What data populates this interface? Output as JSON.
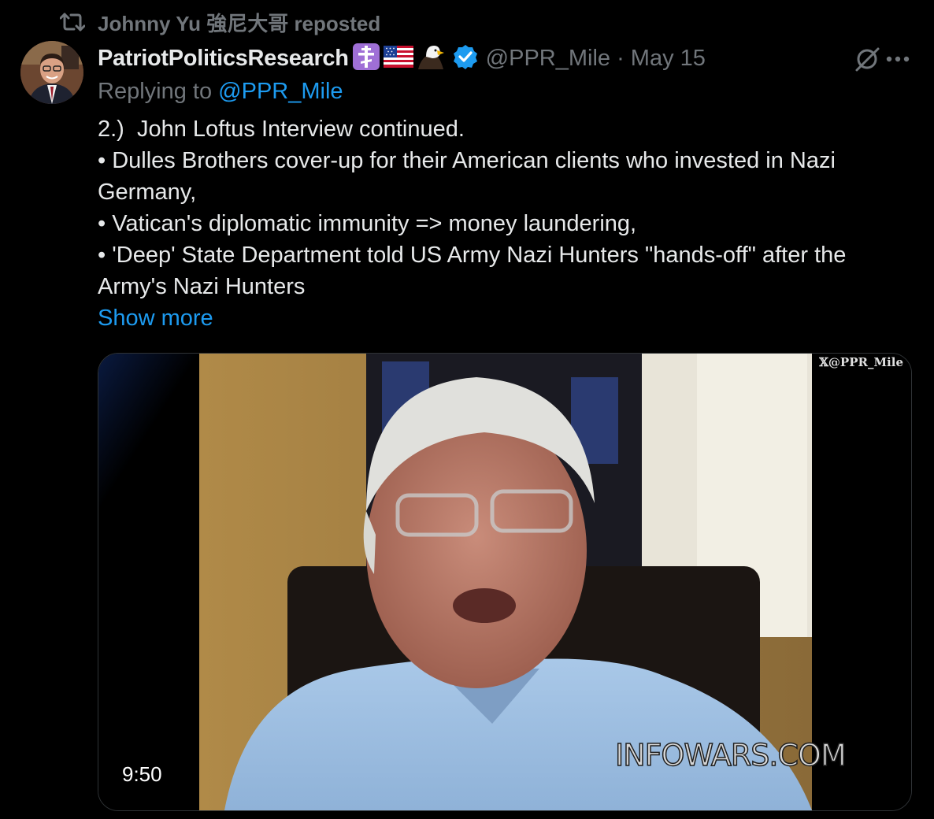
{
  "repost": {
    "icon": "repost-icon",
    "text": "Johnny Yu 強尼大哥 reposted"
  },
  "author": {
    "display_name": "PatriotPoliticsResearch",
    "emojis": [
      "orthodox-cross-emoji",
      "us-flag-emoji",
      "eagle-emoji"
    ],
    "verified_color": "#1d9bf0",
    "handle_date": "@PPR_Mile · May 15"
  },
  "reply": {
    "prefix": "Replying to ",
    "handle": "@PPR_Mile"
  },
  "body": {
    "lines": [
      "2.)  John Loftus Interview continued.",
      "• Dulles Brothers cover-up for their American clients who invested in Nazi Germany,",
      "• Vatican's diplomatic immunity => money laundering,",
      "• 'Deep' State Department told US Army Nazi Hunters \"hands-off\" after the Army's Nazi Hunters"
    ],
    "show_more": "Show more"
  },
  "media": {
    "watermark": "𝕏@PPR_Mile",
    "overlay_text": "INFOWARS.COM",
    "duration": "9:50"
  },
  "colors": {
    "background": "#000000",
    "text": "#e7e9ea",
    "muted": "#71767b",
    "accent": "#1d9bf0"
  }
}
